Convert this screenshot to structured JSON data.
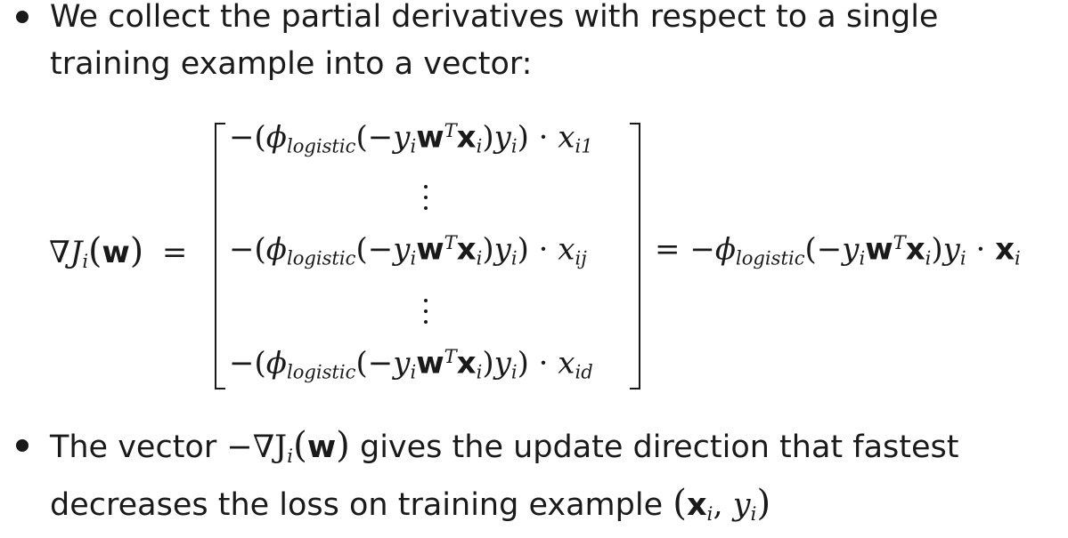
{
  "bullets": [
    {
      "text": "We collect the partial derivatives with respect to a single training example into a vector:"
    },
    {
      "text_before": "The vector ",
      "math": "−∇J",
      "math_sub": "i",
      "math_arg": "w",
      "text_after": " gives the update direction that fastest decreases the loss on training example ",
      "example_x": "x",
      "example_sub": "i",
      "example_y": "y",
      "example_ysub": "i"
    }
  ],
  "equation": {
    "lhs": {
      "nabla": "∇",
      "func": "J",
      "func_sub": "i",
      "arg": "w",
      "equals": "="
    },
    "rows": [
      {
        "index": "i1"
      },
      {
        "index": "ij"
      },
      {
        "index": "id"
      }
    ],
    "row_parts": {
      "neg": "−(",
      "phi": "ϕ",
      "phi_sub": "logistic",
      "open": "(−",
      "y": "y",
      "y_sub": "i",
      "w": "w",
      "T": "T",
      "x": "x",
      "x_sub": "i",
      "close": ")",
      "close2": ")",
      "dot": " · ",
      "xvar": "x"
    },
    "rhs": {
      "equals": "=",
      "neg": "−",
      "phi": "ϕ",
      "phi_sub": "logistic",
      "open": "(−",
      "y": "y",
      "y_sub": "i",
      "w": "w",
      "T": "T",
      "x": "x",
      "x_sub": "i",
      "close": ")",
      "dot": " · "
    }
  }
}
